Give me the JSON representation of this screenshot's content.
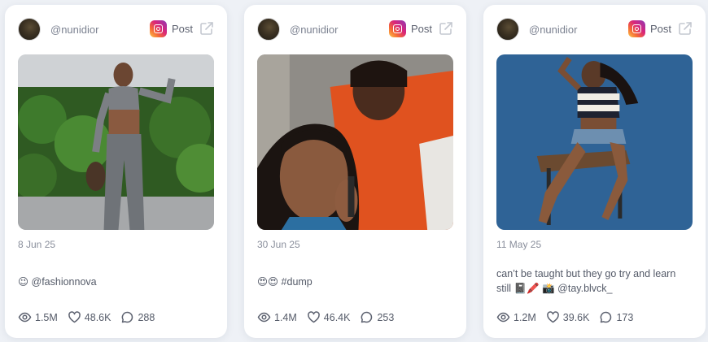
{
  "posts": [
    {
      "username": "@nunidior",
      "platform_label": "Post",
      "date": "8 Jun 25",
      "caption": "😉 @fashionnova",
      "views": "1.5M",
      "likes": "48.6K",
      "comments": "288"
    },
    {
      "username": "@nunidior",
      "platform_label": "Post",
      "date": "30 Jun 25",
      "caption": "😍😍 #dump",
      "views": "1.4M",
      "likes": "46.4K",
      "comments": "253"
    },
    {
      "username": "@nunidior",
      "platform_label": "Post",
      "date": "11 May 25",
      "caption": "can’t be taught but they go try and learn still 📓🖍️ 📸 @tay.blvck_",
      "views": "1.2M",
      "likes": "39.6K",
      "comments": "173"
    }
  ],
  "icons": {
    "platform": "instagram-icon",
    "open": "external-link-icon",
    "views": "eye-icon",
    "likes": "heart-icon",
    "comments": "comment-icon"
  },
  "colors": {
    "page_background": "#eef1f6",
    "card_background": "#ffffff",
    "muted_text": "#8a8f9c"
  }
}
